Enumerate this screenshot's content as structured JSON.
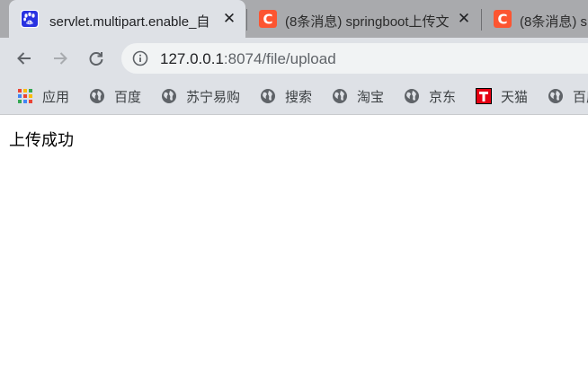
{
  "tabs": [
    {
      "title": "servlet.multipart.enable_自",
      "favicon": "baidu-paw-icon",
      "active": true
    },
    {
      "title": "(8条消息) springboot上传文",
      "favicon": "csdn-c-icon",
      "active": false
    },
    {
      "title": "(8条消息) s",
      "favicon": "csdn-c-icon",
      "active": false
    }
  ],
  "toolbar": {
    "url_host": "127.0.0.1",
    "url_rest": ":8074/file/upload"
  },
  "bookmarks": [
    {
      "label": "应用",
      "icon": "apps-grid-icon"
    },
    {
      "label": "百度",
      "icon": "globe-icon"
    },
    {
      "label": "苏宁易购",
      "icon": "globe-icon"
    },
    {
      "label": "搜索",
      "icon": "globe-icon"
    },
    {
      "label": "淘宝",
      "icon": "globe-icon"
    },
    {
      "label": "京东",
      "icon": "globe-icon"
    },
    {
      "label": "天猫",
      "icon": "tmall-icon"
    },
    {
      "label": "百度",
      "icon": "globe-icon"
    }
  ],
  "page": {
    "message": "上传成功"
  },
  "colors": {
    "tabstrip_bg": "#a9aaad",
    "toolbar_bg": "#dee1e6",
    "omnibox_bg": "#f1f3f4",
    "csdn_red": "#fc5531",
    "tmall_red": "#e60012"
  }
}
